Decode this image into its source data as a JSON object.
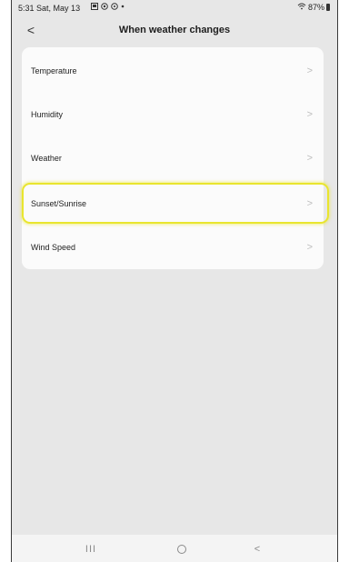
{
  "status_bar": {
    "time": "5:31",
    "date": "Sat, May 13",
    "battery": "87%",
    "icons": [
      "gallery-icon",
      "target-icon",
      "settings-icon",
      "dot-icon"
    ]
  },
  "header": {
    "back": "<",
    "title": "When weather changes"
  },
  "options": [
    {
      "label": "Temperature",
      "chevron": ">"
    },
    {
      "label": "Humidity",
      "chevron": ">"
    },
    {
      "label": "Weather",
      "chevron": ">"
    },
    {
      "label": "Sunset/Sunrise",
      "chevron": ">"
    },
    {
      "label": "Wind Speed",
      "chevron": ">"
    }
  ],
  "highlighted_option": "Sunset/Sunrise",
  "highlight_color": "#e9e52e",
  "nav": {
    "recents": "III",
    "home": "O",
    "back": "<"
  }
}
